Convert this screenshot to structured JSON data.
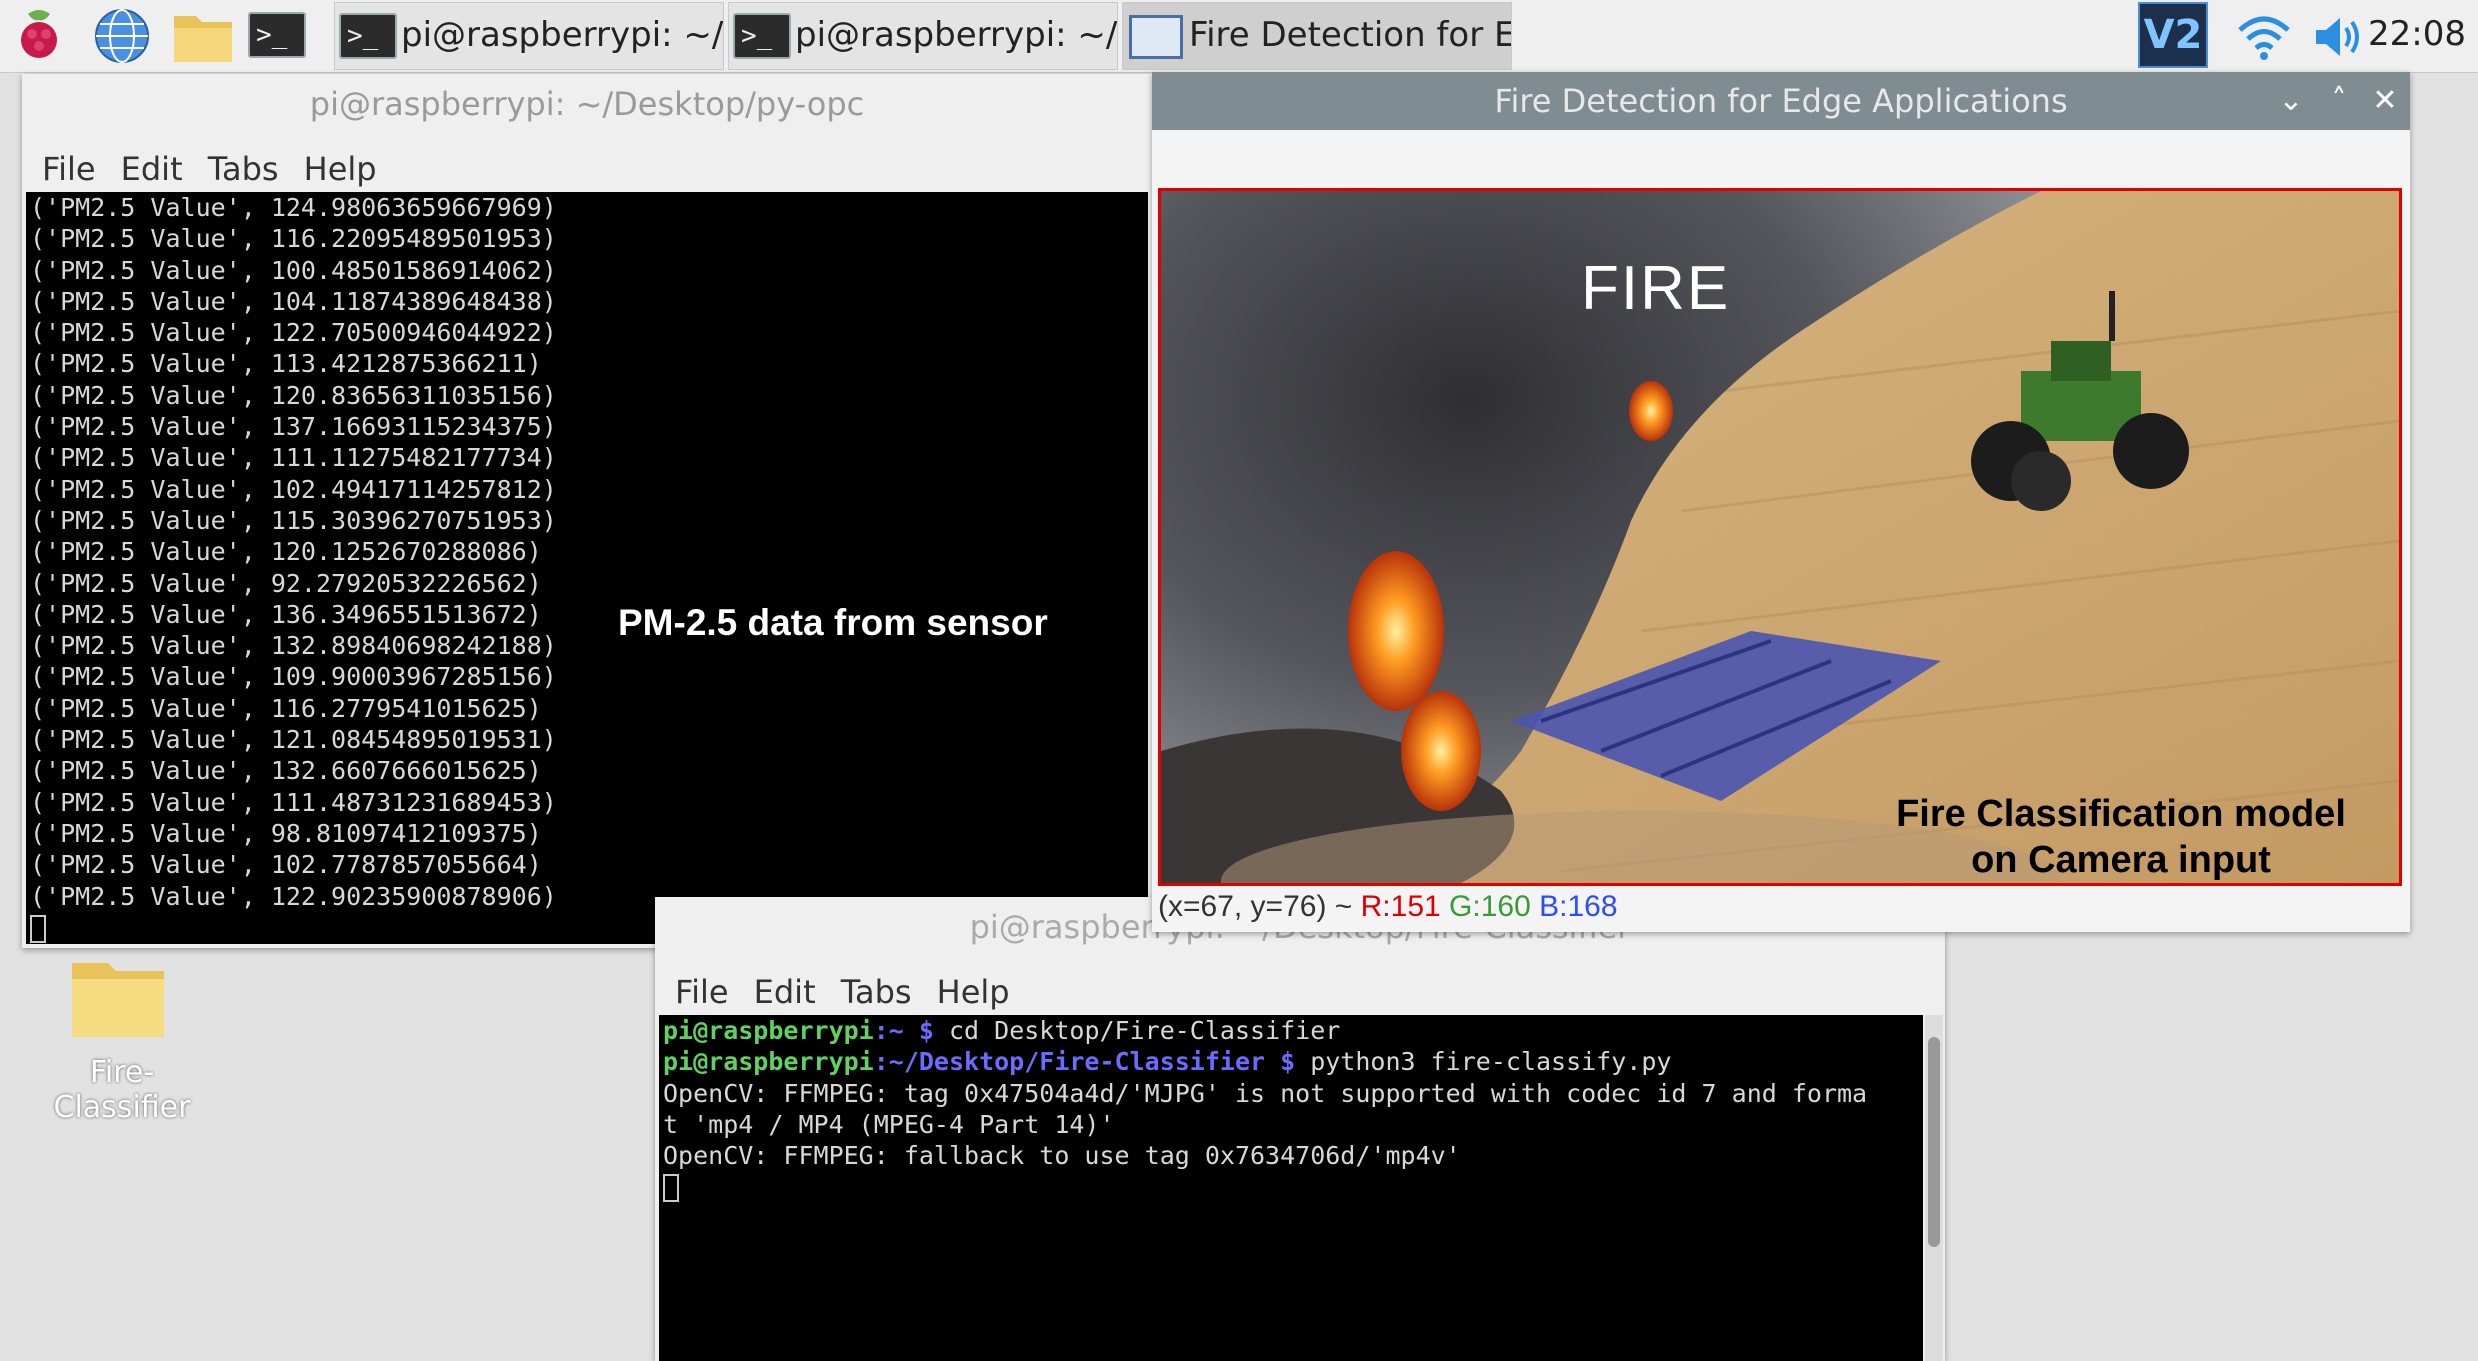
{
  "taskbar": {
    "tasks": [
      {
        "label": "pi@raspberrypi: ~/De..."
      },
      {
        "label": "pi@raspberrypi: ~/De..."
      },
      {
        "label": "Fire Detection for Edg..."
      }
    ],
    "clock": "22:08",
    "icons": [
      "raspberry-menu-icon",
      "web-browser-icon",
      "file-manager-icon",
      "terminal-launcher-icon",
      "vnc-icon",
      "wifi-icon",
      "volume-icon"
    ]
  },
  "desktop": {
    "folder_label": "Fire-Classifier"
  },
  "win1": {
    "title": "pi@raspberrypi: ~/Desktop/py-opc",
    "menu": [
      "File",
      "Edit",
      "Tabs",
      "Help"
    ],
    "lines": [
      "('PM2.5 Value', 124.98063659667969)",
      "('PM2.5 Value', 116.22095489501953)",
      "('PM2.5 Value', 100.48501586914062)",
      "('PM2.5 Value', 104.11874389648438)",
      "('PM2.5 Value', 122.70500946044922)",
      "('PM2.5 Value', 113.4212875366211)",
      "('PM2.5 Value', 120.83656311035156)",
      "('PM2.5 Value', 137.16693115234375)",
      "('PM2.5 Value', 111.11275482177734)",
      "('PM2.5 Value', 102.49417114257812)",
      "('PM2.5 Value', 115.30396270751953)",
      "('PM2.5 Value', 120.1252670288086)",
      "('PM2.5 Value', 92.27920532226562)",
      "('PM2.5 Value', 136.3496551513672)",
      "('PM2.5 Value', 132.89840698242188)",
      "('PM2.5 Value', 109.90003967285156)",
      "('PM2.5 Value', 116.2779541015625)",
      "('PM2.5 Value', 121.08454895019531)",
      "('PM2.5 Value', 132.6607666015625)",
      "('PM2.5 Value', 111.48731231689453)",
      "('PM2.5 Value', 98.81097412109375)",
      "('PM2.5 Value', 102.7787857055664)",
      "('PM2.5 Value', 122.90235900878906)"
    ],
    "annotation": "PM-2.5 data from sensor"
  },
  "win2": {
    "title": "Fire Detection for Edge Applications",
    "frame_label": "FIRE",
    "annotation_line1": "Fire Classification model",
    "annotation_line2": "on Camera input",
    "status": {
      "coords": "(x=67, y=76) ~",
      "r": "R:151",
      "g": "G:160",
      "b": "B:168"
    },
    "colors": {
      "titlebar": "#7f8c92",
      "frame_border": "#e00000"
    }
  },
  "win3": {
    "title": "pi@raspberrypi: ~/Desktop/Fire-Classifier",
    "menu": [
      "File",
      "Edit",
      "Tabs",
      "Help"
    ],
    "prompt1_user": "pi@raspberrypi",
    "prompt1_path": ":~ $",
    "cmd1": " cd Desktop/Fire-Classifier",
    "prompt2_user": "pi@raspberrypi",
    "prompt2_path": ":~/Desktop/Fire-Classifier $",
    "cmd2": " python3 fire-classify.py",
    "out1": "OpenCV: FFMPEG: tag 0x47504a4d/'MJPG' is not supported with codec id 7 and forma",
    "out2": "t 'mp4 / MP4 (MPEG-4 Part 14)'",
    "out3": "OpenCV: FFMPEG: fallback to use tag 0x7634706d/'mp4v'"
  }
}
